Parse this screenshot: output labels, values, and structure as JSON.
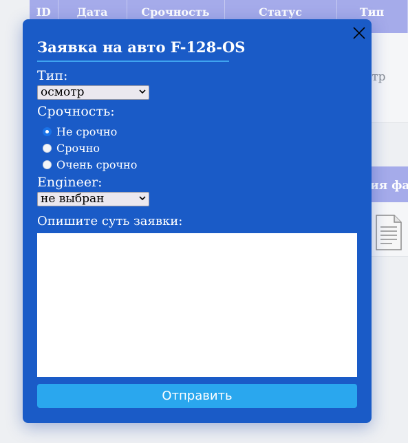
{
  "background": {
    "table_headers": [
      "ID",
      "Дата",
      "Срочность",
      "Статус",
      "Тип"
    ],
    "row_type_partial": "отр",
    "section_header_partial": "ия фа"
  },
  "modal": {
    "title": "Заявка на авто F-128-OS",
    "type_label": "Тип:",
    "type_selected": "осмотр",
    "urgency_label": "Срочность:",
    "urgency_options": [
      {
        "label": "Не срочно",
        "checked": true
      },
      {
        "label": "Срочно",
        "checked": false
      },
      {
        "label": "Очень срочно",
        "checked": false
      }
    ],
    "engineer_label": "Engineer:",
    "engineer_selected": "не выбран",
    "description_label": "Опишите суть заявки:",
    "description_value": "",
    "submit_label": "Отправить"
  },
  "colors": {
    "modal_bg": "#1a5bc7",
    "submit_bg": "#2aa7ee",
    "header_bg": "#a5abea",
    "radio_checked": "#1a73e8"
  },
  "icons": [
    "close-icon",
    "chevron-down-icon",
    "document-icon"
  ]
}
